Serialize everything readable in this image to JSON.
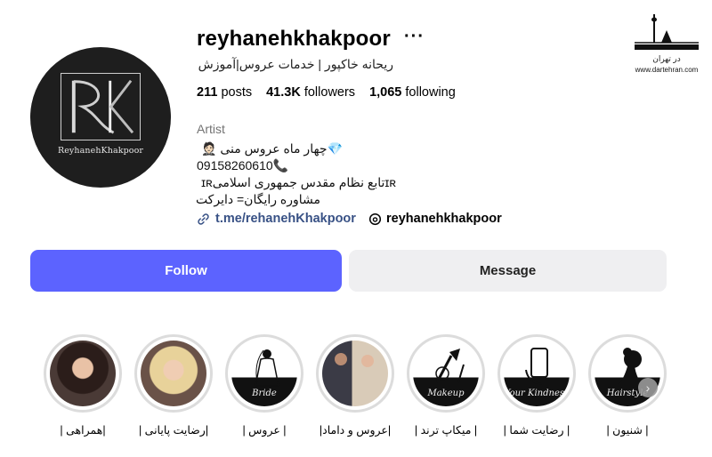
{
  "profile": {
    "avatar_brand": "ReyhanehKhakpoor",
    "username": "reyhanehkhakpoor",
    "more_label": "···",
    "full_name": "ریحانه خاکپور | خدمات عروس|آموزش"
  },
  "stats": {
    "posts_count": "211",
    "posts_label": "posts",
    "followers_count": "41.3K",
    "followers_label": "followers",
    "following_count": "1,065",
    "following_label": "following"
  },
  "bio": {
    "category": "Artist",
    "line1": "💎چهار ماه عروس منی 🤵🏻",
    "line2": "09158260610📞",
    "line3": "ɪʀتابع نظام مقدس جمهوری اسلامیɪʀ",
    "line4": "مشاوره رایگان= دایرکت",
    "link_text": "t.me/rehanehKhakpoor",
    "threads_handle": "reyhanehkhakpoor"
  },
  "buttons": {
    "follow": "Follow",
    "message": "Message"
  },
  "highlights": [
    {
      "label": "|همراهی |",
      "caption": ""
    },
    {
      "label": "|رضایت پایانی |",
      "caption": ""
    },
    {
      "label": "| عروس |",
      "caption": "Bride"
    },
    {
      "label": "|عروس و داماد|",
      "caption": ""
    },
    {
      "label": "| میکاپ ترند |",
      "caption": "Makeup"
    },
    {
      "label": "| رضایت شما |",
      "caption": "Your Kindness"
    },
    {
      "label": "| شنیون |",
      "caption": "Hairstyle"
    }
  ],
  "watermark": {
    "text": "در تهران",
    "url": "www.dartehran.com"
  },
  "icons": {
    "more": "more-options-icon",
    "link": "link-chain-icon",
    "threads": "threads-icon",
    "scroll": "chevron-right-icon"
  },
  "colors": {
    "follow_button": "#5c63ff",
    "message_button": "#efeff1",
    "link": "#385185",
    "muted": "#737373"
  }
}
